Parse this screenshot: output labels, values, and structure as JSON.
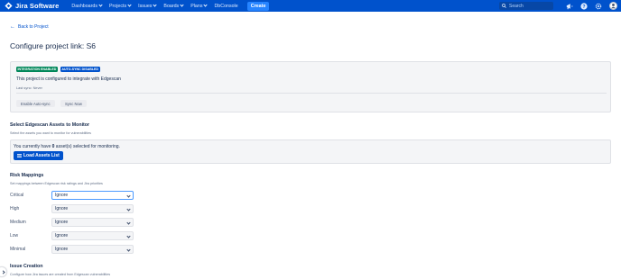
{
  "topnav": {
    "logo_text": "Jira Software",
    "items": [
      {
        "label": "Dashboards",
        "dropdown": true
      },
      {
        "label": "Projects",
        "dropdown": true
      },
      {
        "label": "Issues",
        "dropdown": true
      },
      {
        "label": "Boards",
        "dropdown": true
      },
      {
        "label": "Plans",
        "dropdown": true
      },
      {
        "label": "DbConsole",
        "dropdown": false
      }
    ],
    "create_label": "Create",
    "search_placeholder": "Search",
    "icons": [
      "megaphone-icon",
      "help-icon",
      "settings-icon",
      "user-avatar"
    ],
    "brand_color": "#0052cc"
  },
  "back_link": "Back to Project",
  "page_title": "Configure project link: S6",
  "integration_panel": {
    "lozenges": [
      {
        "label": "INTEGRATION ENABLED",
        "color": "#00875a"
      },
      {
        "label": "AUTO-SYNC DISABLED",
        "color": "#0052cc"
      }
    ],
    "description": "This project is configured to integrate with Edgescan",
    "last_sync": "Last sync: Never",
    "buttons": {
      "enable_autosync": "Enable Auto-sync",
      "sync_now": "Sync Now"
    }
  },
  "assets_section": {
    "title": "Select Edgescan Assets to Monitor",
    "subtitle": "Select the assets you want to monitor for vulnerabilities",
    "message_prefix": "You currently have ",
    "message_count": "0",
    "message_suffix": " asset(s) selected for monitoring.",
    "load_button": "Load Assets List"
  },
  "risk_section": {
    "title": "Risk Mappings",
    "subtitle": "Set mappings between Edgescan risk ratings and Jira priorities",
    "rows": [
      {
        "label": "Critical",
        "value": "Ignore"
      },
      {
        "label": "High",
        "value": "Ignore"
      },
      {
        "label": "Medium",
        "value": "Ignore"
      },
      {
        "label": "Low",
        "value": "Ignore"
      },
      {
        "label": "Minimal",
        "value": "Ignore"
      }
    ]
  },
  "issue_section": {
    "title": "Issue Creation",
    "subtitle": "Configure how Jira issues are created from Edgescan vulnerabilities"
  }
}
